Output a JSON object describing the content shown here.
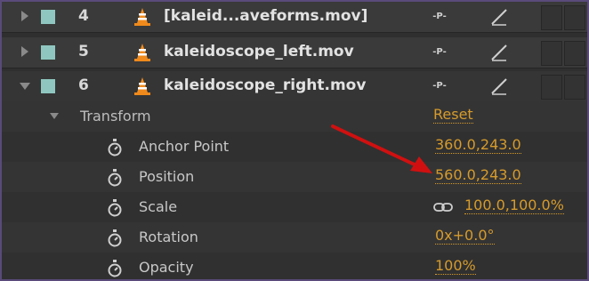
{
  "layers": [
    {
      "number": "4",
      "name": "[kaleid...aveforms.mov]",
      "shy_icon": "shy-switch-icon",
      "quality_icon": "quality-switch-icon"
    },
    {
      "number": "5",
      "name": "kaleidoscope_left.mov",
      "shy_icon": "shy-switch-icon",
      "quality_icon": "quality-switch-icon"
    },
    {
      "number": "6",
      "name": "kaleidoscope_right.mov",
      "shy_icon": "shy-switch-icon",
      "quality_icon": "quality-switch-icon"
    }
  ],
  "transform": {
    "label": "Transform",
    "reset_label": "Reset"
  },
  "properties": {
    "anchor_point": {
      "label": "Anchor Point",
      "value": "360.0,243.0"
    },
    "position": {
      "label": "Position",
      "value": "560.0,243.0"
    },
    "scale": {
      "label": "Scale",
      "value": "100.0,100.0%"
    },
    "rotation": {
      "label": "Rotation",
      "value": "0x+0.0°"
    },
    "opacity": {
      "label": "Opacity",
      "value": "100%"
    }
  },
  "colors": {
    "label_swatch": "#8fc7c0",
    "value_orange": "#d69b2b",
    "annotation_arrow": "#d01010"
  }
}
